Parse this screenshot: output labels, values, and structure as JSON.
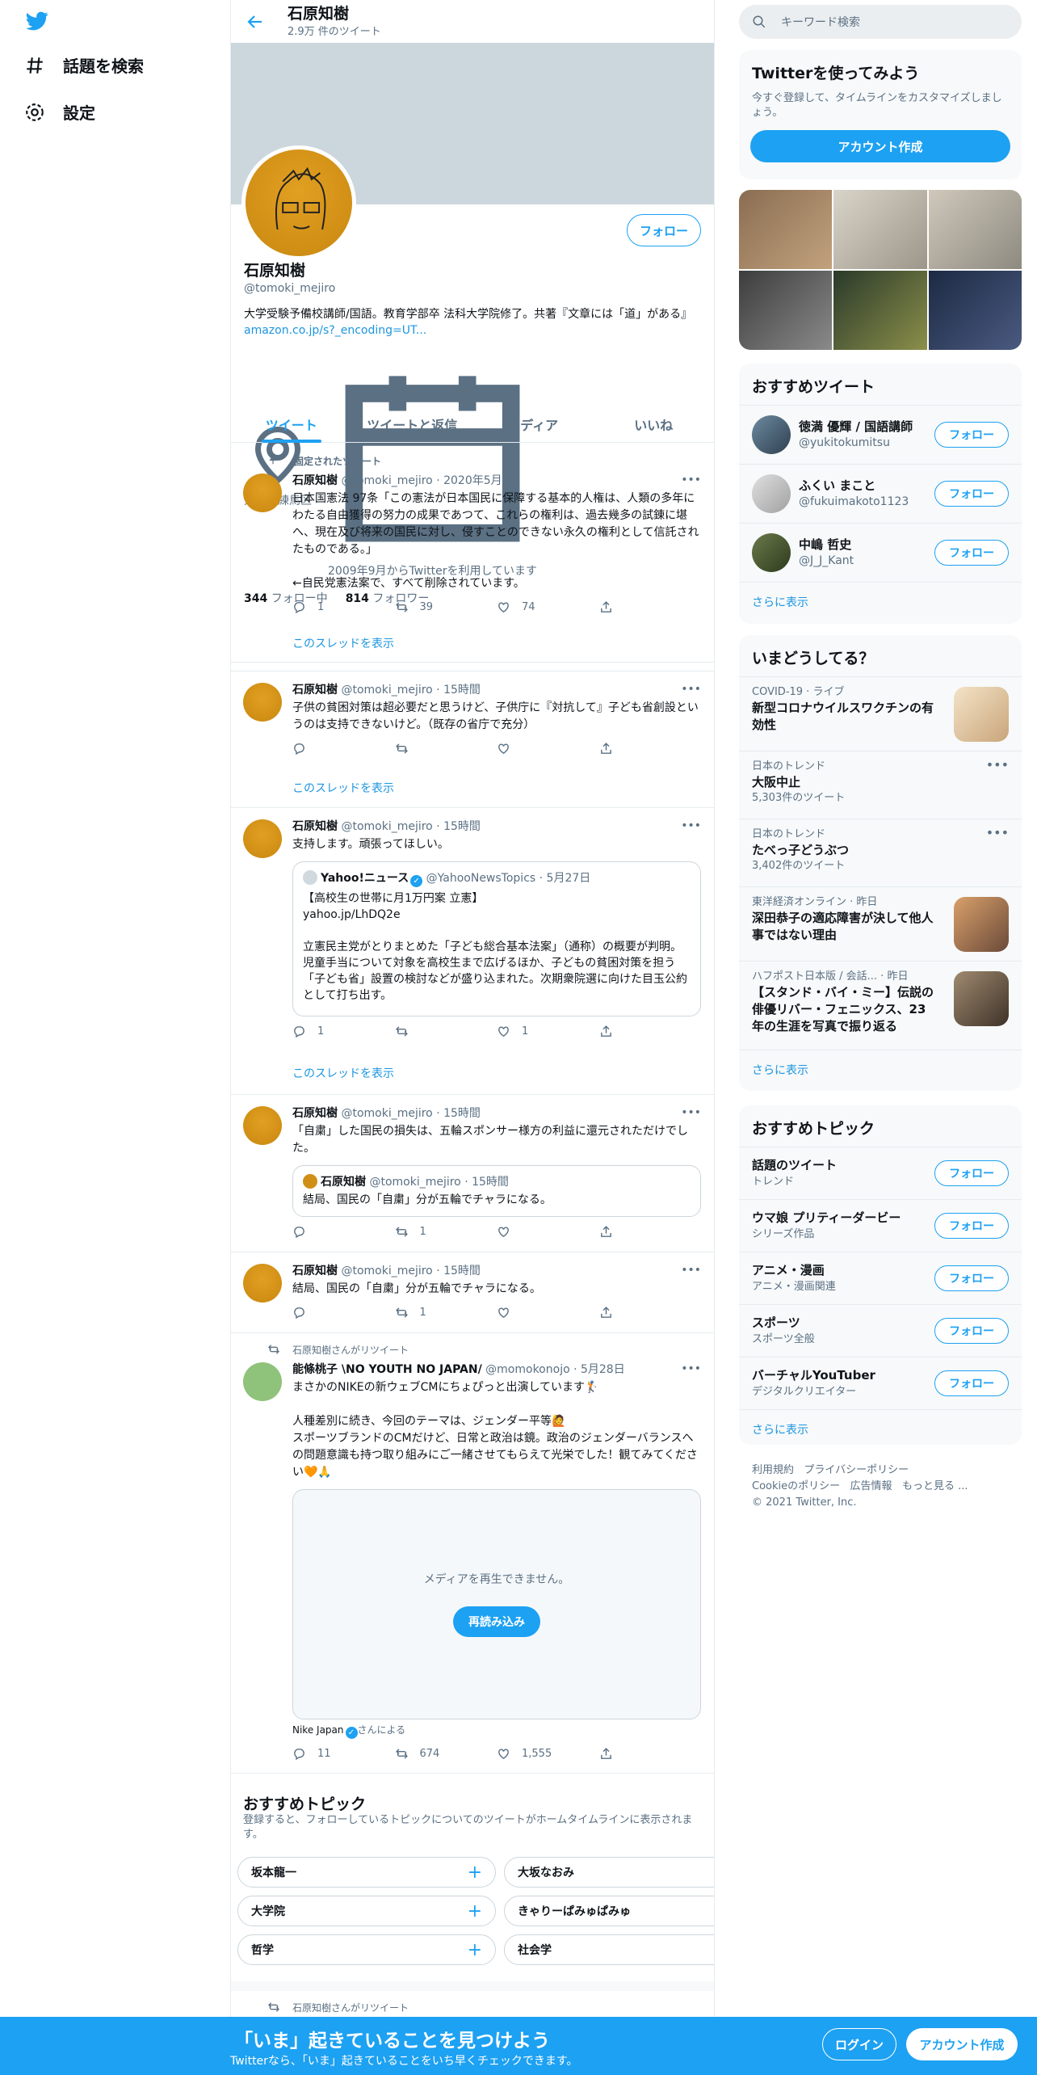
{
  "nav": {
    "explore": "話題を検索",
    "settings": "設定"
  },
  "header": {
    "name": "石原知樹",
    "tweet_count": "2.9万 件のツイート"
  },
  "profile": {
    "follow": "フォロー",
    "name": "石原知樹",
    "handle": "@tomoki_mejiro",
    "bio": "大学受験予備校講師/国語。教育学部卒 法科大学院修了。共著『文章には「道」がある』",
    "bio_link": "amazon.co.jp/s?_encoding=UT...",
    "location": "東京都練馬区",
    "joined": "2009年9月からTwitterを利用しています",
    "following_count": "344",
    "following_label": "フォロー中",
    "followers_count": "814",
    "followers_label": "フォロワー"
  },
  "tabs": [
    "ツイート",
    "ツイートと返信",
    "メディア",
    "いいね"
  ],
  "tweets": [
    {
      "pinned": "固定されたツイート",
      "name": "石原知樹",
      "handle_time": "@tomoki_mejiro · 2020年5月7日",
      "text": "日本国憲法 97条「この憲法が日本国民に保障する基本的人権は、人類の多年にわたる自由獲得の努力の成果であつて、これらの権利は、過去幾多の試錬に堪へ、現在及び将来の国民に対し、侵すことのできない永久の権利として信託されたものである。」\n\n←自民党憲法案で、すべて削除されています。",
      "replies": "1",
      "retweets": "39",
      "likes": "74",
      "thread": "このスレッドを表示"
    },
    {
      "name": "石原知樹",
      "handle_time": "@tomoki_mejiro · 15時間",
      "text": "子供の貧困対策は超必要だと思うけど、子供庁に『対抗して』子ども省創設というのは支持できないけど。（既存の省庁で充分）",
      "thread": "このスレッドを表示"
    },
    {
      "name": "石原知樹",
      "handle_time": "@tomoki_mejiro · 15時間",
      "text": "支持します。頑張ってほしい。",
      "quote_name": "Yahoo!ニュース",
      "quote_handle_time": "@YahooNewsTopics · 5月27日",
      "quote_text": "【高校生の世帯に月1万円案 立憲】\nyahoo.jp/LhDQ2e\n\n立憲民主党がとりまとめた「子ども総合基本法案」（通称）の概要が判明。児童手当について対象を高校生まで広げるほか、子どもの貧困対策を担う「子ども省」設置の検討などが盛り込まれた。次期衆院選に向けた目玉公約として打ち出す。",
      "replies": "1",
      "likes": "1",
      "thread": "このスレッドを表示"
    },
    {
      "name": "石原知樹",
      "handle_time": "@tomoki_mejiro · 15時間",
      "text": "「自粛」した国民の損失は、五輪スポンサー様方の利益に還元されただけでした。",
      "quote_name": "石原知樹",
      "quote_handle_time": "@tomoki_mejiro · 15時間",
      "quote_text": "結局、国民の「自粛」分が五輪でチャラになる。",
      "retweets": "1"
    },
    {
      "name": "石原知樹",
      "handle_time": "@tomoki_mejiro · 15時間",
      "text": "結局、国民の「自粛」分が五輪でチャラになる。",
      "retweets": "1"
    },
    {
      "retweeted_by": "石原知樹さんがリツイート",
      "name": "能條桃子 \\NO YOUTH NO JAPAN/",
      "handle_time": "@momokonojo · 5月28日",
      "text": "まさかのNIKEの新ウェブCMにちょぴっと出演しています🏌\n\n人種差別に続き、今回のテーマは、ジェンダー平等🙋\nスポーツブランドのCMだけど、日常と政治は鏡。政治のジェンダーバランスへの問題意識も持つ取り組みにご一緒させてもらえて光栄でした！観てみてください🧡🙏",
      "media_msg": "メディアを再生できません。",
      "reload": "再読み込み",
      "promoted_by": "Nike Japan",
      "promoted_suffix": "さんによる",
      "replies": "11",
      "retweets": "674",
      "likes": "1,555"
    }
  ],
  "topics_section": {
    "title": "おすすめトピック",
    "desc": "登録すると、フォローしているトピックについてのツイートがホームタイムラインに表示されます。",
    "pills": [
      "坂本龍一",
      "大坂なおみ",
      "大学院",
      "きゃりーぱみゅぱみゅ",
      "哲学",
      "社会学"
    ]
  },
  "last_retweet": "石原知樹さんがリツイート",
  "right": {
    "search_placeholder": "キーワード検索",
    "signup_title": "Twitterを使ってみよう",
    "signup_desc": "今すぐ登録して、タイムラインをカスタマイズしましょう。",
    "signup_button": "アカウント作成",
    "rec_title": "おすすめツイート",
    "rec_users": [
      {
        "name": "徳満 優輝 / 国語講師",
        "handle": "@yukitokumitsu"
      },
      {
        "name": "ふくい まこと",
        "handle": "@fukuimakoto1123"
      },
      {
        "name": "中嶋 哲史",
        "handle": "@J_J_Kant"
      }
    ],
    "follow": "フォロー",
    "show_more": "さらに表示",
    "trends_title": "いまどうしてる？",
    "trends": [
      {
        "meta": "COVID-19 · ライブ",
        "title": "新型コロナウイルスワクチンの有効性"
      },
      {
        "meta": "日本のトレンド",
        "title": "大阪中止",
        "count": "5,303件のツイート"
      },
      {
        "meta": "日本のトレンド",
        "title": "たべっ子どうぶつ",
        "count": "3,402件のツイート"
      },
      {
        "meta": "東洋経済オンライン · 昨日",
        "title": "深田恭子の適応障害が決して他人事ではない理由"
      },
      {
        "meta": "ハフポスト日本版 / 会話... · 昨日",
        "title": "【スタンド・バイ・ミー】伝説の俳優リバー・フェニックス、23年の生涯を写真で振り返る"
      }
    ],
    "topics_title": "おすすめトピック",
    "topics": [
      {
        "name": "話題のツイート",
        "cat": "トレンド"
      },
      {
        "name": "ウマ娘 プリティーダービー",
        "cat": "シリーズ作品"
      },
      {
        "name": "アニメ・漫画",
        "cat": "アニメ・漫画関連"
      },
      {
        "name": "スポーツ",
        "cat": "スポーツ全般"
      },
      {
        "name": "バーチャルYouTuber",
        "cat": "デジタルクリエイター"
      }
    ],
    "footer": {
      "terms": "利用規約",
      "privacy": "プライバシーポリシー",
      "cookie": "Cookieのポリシー",
      "ads": "広告情報",
      "more": "もっと見る ...",
      "copyright": "© 2021 Twitter, Inc."
    }
  },
  "bottom": {
    "headline": "「いま」起きていることを見つけよう",
    "sub": "Twitterなら、「いま」起きていることをいち早くチェックできます。",
    "login": "ログイン",
    "signup": "アカウント作成"
  },
  "colors": {
    "accent": "#1da1f2",
    "link": "#1b95e0"
  }
}
